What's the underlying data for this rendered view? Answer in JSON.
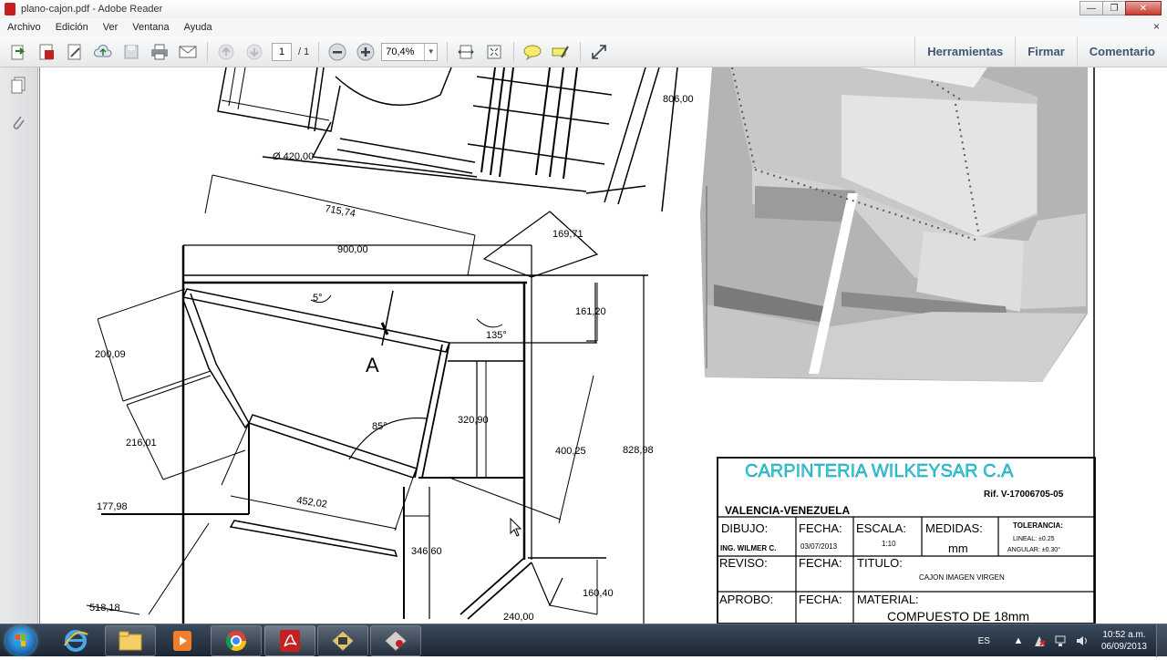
{
  "window": {
    "title": "plano-cajon.pdf - Adobe Reader",
    "minimize": "—",
    "maximize": "❐",
    "close": "✕"
  },
  "menu": {
    "items": [
      "Archivo",
      "Edición",
      "Ver",
      "Ventana",
      "Ayuda"
    ],
    "close_doc": "×"
  },
  "toolbar": {
    "page_current": "1",
    "page_total": "/ 1",
    "zoom": "70,4%",
    "tools_label": "Herramientas",
    "sign_label": "Firmar",
    "comment_label": "Comentario"
  },
  "drawing": {
    "dims": {
      "d420": "Ø 420,00",
      "d806": "806,00",
      "d715": "715,74",
      "d900": "900,00",
      "d169": "169,71",
      "d161": "161,20",
      "d200": "200,09",
      "d216": "216,01",
      "d320": "320,90",
      "d400": "400,25",
      "d828": "828,98",
      "d177": "177,98",
      "d452": "452,02",
      "d346": "346,60",
      "d160": "160,40",
      "d518": "518,18",
      "d240": "240,00",
      "ang1": "5°",
      "ang2": "135°",
      "ang3": "85°",
      "sectionA": "A"
    },
    "titleblock": {
      "company": "CARPINTERIA WILKEYSAR C.A",
      "rif": "Rif. V-17006705-05",
      "location": "VALENCIA-VENEZUELA",
      "dibujo_label": "DIBUJO:",
      "dibujo_name": "ING. WILMER C.",
      "fecha_label": "FECHA:",
      "fecha_value": "03/07/2013",
      "escala_label": "ESCALA:",
      "escala_value": "1:10",
      "medidas_label": "MEDIDAS:",
      "medidas_value": "mm",
      "tolerancia_label": "TOLERANCIA:",
      "tol_lineal": "LINEAL: ±0.25",
      "tol_angular": "ANGULAR: ±0.30°",
      "reviso_label": "REVISO:",
      "fecha2_label": "FECHA:",
      "titulo_label": "TITULO:",
      "titulo_value": "CAJON IMAGEN VIRGEN",
      "aprobo_label": "APROBO:",
      "fecha3_label": "FECHA:",
      "material_label": "MATERIAL:",
      "material_value": "COMPUESTO DE 18mm"
    }
  },
  "taskbar": {
    "lang": "ES",
    "time": "10:52 a.m.",
    "date": "06/09/2013"
  },
  "colors": {
    "accent_text": "#3e5673",
    "company_cyan": "#27d3e8",
    "pdf_red": "#c51f1f"
  }
}
